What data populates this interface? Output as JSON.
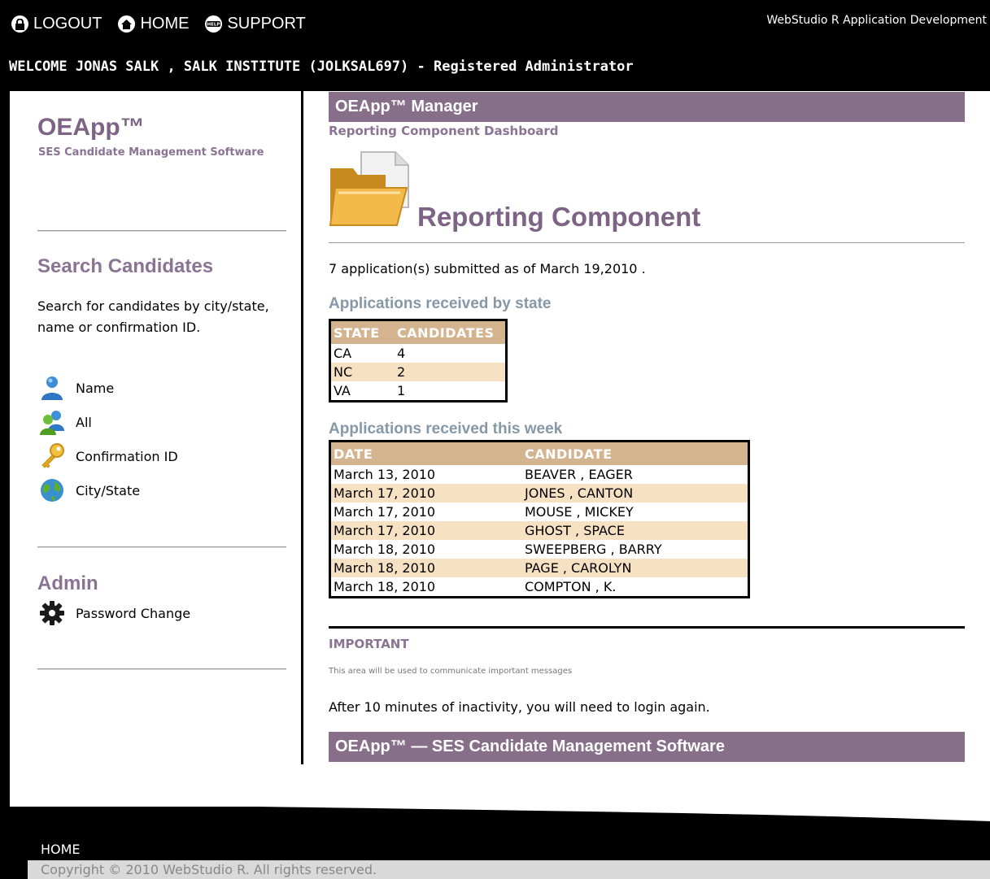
{
  "topbar": {
    "nav": [
      {
        "label": "LOGOUT",
        "icon": "lock-icon"
      },
      {
        "label": "HOME",
        "icon": "home-icon"
      },
      {
        "label": "SUPPORT",
        "icon": "help-icon"
      }
    ],
    "brand": "WebStudio R Application Development",
    "welcome": "WELCOME JONAS SALK , SALK INSTITUTE (JOLKSAL697) - Registered Administrator"
  },
  "sidebar": {
    "app_title": "OEApp™",
    "app_subtitle": "SES Candidate Management Software",
    "search_heading": "Search Candidates",
    "search_text": "Search for candidates by city/state, name or confirmation ID.",
    "search_links": [
      {
        "label": "Name",
        "icon": "user-icon"
      },
      {
        "label": "All",
        "icon": "users-icon"
      },
      {
        "label": "Confirmation ID",
        "icon": "key-icon"
      },
      {
        "label": "City/State",
        "icon": "globe-icon"
      }
    ],
    "admin_heading": "Admin",
    "admin_links": [
      {
        "label": "Password Change",
        "icon": "gear-icon"
      }
    ]
  },
  "main": {
    "manager_bar": "OEApp™ Manager",
    "dashboard_link": "Reporting Component Dashboard",
    "page_title": "Reporting Component",
    "summary": "7 application(s) submitted as of March 19,2010 .",
    "by_state": {
      "heading": "Applications received by state",
      "columns": [
        "STATE",
        "CANDIDATES"
      ],
      "rows": [
        [
          "CA",
          "4"
        ],
        [
          "NC",
          "2"
        ],
        [
          "VA",
          "1"
        ]
      ]
    },
    "this_week": {
      "heading": "Applications received this week",
      "columns": [
        "DATE",
        "CANDIDATE"
      ],
      "rows": [
        [
          "March 13, 2010",
          "BEAVER , EAGER"
        ],
        [
          "March 17, 2010",
          "JONES , CANTON"
        ],
        [
          "March 17, 2010",
          "MOUSE , MICKEY"
        ],
        [
          "March 17, 2010",
          "GHOST , SPACE"
        ],
        [
          "March 18, 2010",
          "SWEEPBERG , BARRY"
        ],
        [
          "March 18, 2010",
          "PAGE , CAROLYN"
        ],
        [
          "March 18, 2010",
          "COMPTON , K."
        ]
      ]
    },
    "important_label": "IMPORTANT",
    "important_text": "This area will be used to communicate important messages",
    "inactivity": "After 10 minutes of inactivity, you will need to login again.",
    "footer_bar": "OEApp™  —  SES Candidate Management Software"
  },
  "footer": {
    "home": "HOME",
    "copyright": "Copyright © 2010 WebStudio R. All rights reserved."
  },
  "colors": {
    "accent_purple": "#876f89",
    "heading_purple": "#7d6485",
    "table_header": "#d4b48f",
    "table_alt_row": "#f6e1c3",
    "section_heading": "#8698a7"
  }
}
